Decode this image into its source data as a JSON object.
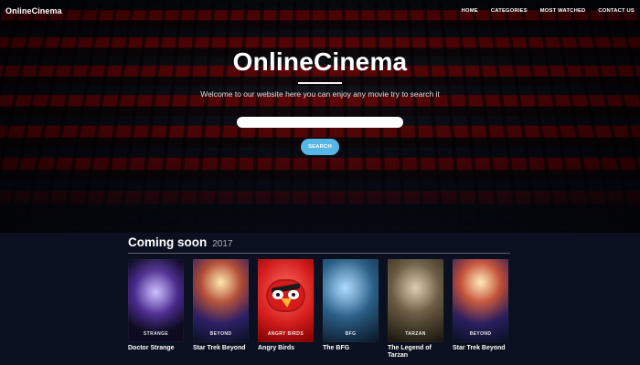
{
  "brand": {
    "name": "OnlineCinema"
  },
  "nav": {
    "items": [
      {
        "label": "HOME"
      },
      {
        "label": "CATEGORIES"
      },
      {
        "label": "MOST WATCHED"
      },
      {
        "label": "CONTACT US"
      }
    ]
  },
  "hero": {
    "title": "OnlineCinema",
    "subtitle": "Welcome to our website here you can enjoy any movie try to search it",
    "search": {
      "value": "",
      "placeholder": "",
      "button_label": "SEARCH"
    }
  },
  "coming_soon": {
    "title": "Coming soon",
    "year": "2017",
    "movies": [
      {
        "title": "Doctor Strange",
        "poster_label": "STRANGE",
        "poster_icon": "poster-icon"
      },
      {
        "title": "Star Trek Beyond",
        "poster_label": "BEYOND",
        "poster_icon": "poster-icon"
      },
      {
        "title": "Angry Birds",
        "poster_label": "ANGRY BIRDS",
        "poster_icon": "poster-icon"
      },
      {
        "title": "The BFG",
        "poster_label": "BFG",
        "poster_icon": "poster-icon"
      },
      {
        "title": "The Legend of Tarzan",
        "poster_label": "TARZAN",
        "poster_icon": "poster-icon"
      },
      {
        "title": "Star Trek Beyond",
        "poster_label": "BEYOND",
        "poster_icon": "poster-icon"
      }
    ]
  },
  "colors": {
    "background": "#0b1020",
    "accent": "#56b7e6",
    "seat_red": "#b10000"
  }
}
